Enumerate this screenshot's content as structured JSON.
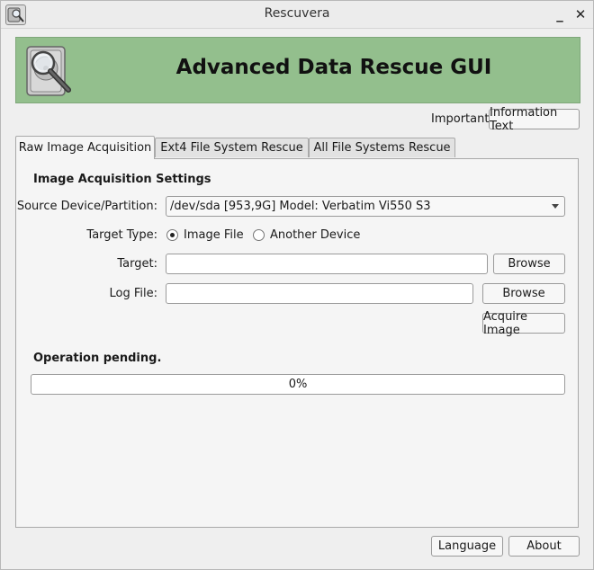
{
  "window": {
    "title": "Rescuvera",
    "minimize_glyph": "_",
    "close_glyph": "✕"
  },
  "banner": {
    "title": "Advanced Data Rescue GUI",
    "logo_icon": "hard-drive-magnifier-icon",
    "background_color": "#93bf8d"
  },
  "important": {
    "label": "Important:",
    "button_label": "Information Text"
  },
  "tabs": [
    {
      "label": "Raw Image Acquisition",
      "active": true
    },
    {
      "label": "Ext4 File System Rescue",
      "active": false
    },
    {
      "label": "All File Systems Rescue",
      "active": false
    }
  ],
  "acquisition": {
    "section_title": "Image Acquisition Settings",
    "source_label": "Source Device/Partition:",
    "source_value": "/dev/sda [953,9G] Model: Verbatim Vi550 S3",
    "target_type_label": "Target Type:",
    "target_type_options": [
      "Image File",
      "Another Device"
    ],
    "target_type_selected": "Image File",
    "target_label": "Target:",
    "target_value": "",
    "target_browse": "Browse",
    "logfile_label": "Log File:",
    "logfile_value": "",
    "logfile_browse": "Browse",
    "acquire_button": "Acquire Image"
  },
  "status": {
    "text": "Operation pending.",
    "progress_percent": 0,
    "progress_text": "0%",
    "progress_color": "#5a9bd4"
  },
  "footer": {
    "language_button": "Language",
    "about_button": "About"
  }
}
